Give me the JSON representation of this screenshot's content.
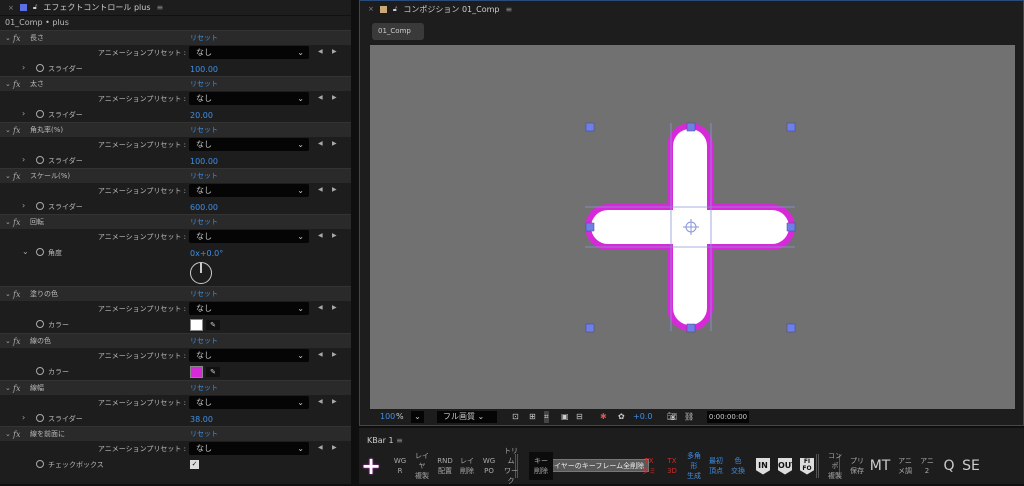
{
  "left_panel": {
    "title": "エフェクトコントロール plus",
    "subtitle": "01_Comp • plus",
    "color": "#5b6fe6",
    "effects": [
      {
        "name": "長さ",
        "reset": "リセット",
        "preset_label": "アニメーションプリセット :",
        "preset": "なし",
        "param": "スライダー",
        "value": "100.00",
        "kind": "slider"
      },
      {
        "name": "太さ",
        "reset": "リセット",
        "preset_label": "アニメーションプリセット :",
        "preset": "なし",
        "param": "スライダー",
        "value": "20.00",
        "kind": "slider"
      },
      {
        "name": "角丸率(%)",
        "reset": "リセット",
        "preset_label": "アニメーションプリセット :",
        "preset": "なし",
        "param": "スライダー",
        "value": "100.00",
        "kind": "slider"
      },
      {
        "name": "スケール(%)",
        "reset": "リセット",
        "preset_label": "アニメーションプリセット :",
        "preset": "なし",
        "param": "スライダー",
        "value": "600.00",
        "kind": "slider"
      },
      {
        "name": "回転",
        "reset": "リセット",
        "preset_label": "アニメーションプリセット :",
        "preset": "なし",
        "param": "角度",
        "value": "0x+0.0°",
        "kind": "angle"
      },
      {
        "name": "塗りの色",
        "reset": "リセット",
        "preset_label": "アニメーションプリセット :",
        "preset": "なし",
        "param": "カラー",
        "color": "#ffffff",
        "kind": "color"
      },
      {
        "name": "線の色",
        "reset": "リセット",
        "preset_label": "アニメーションプリセット :",
        "preset": "なし",
        "param": "カラー",
        "color": "#d62ad8",
        "kind": "color"
      },
      {
        "name": "線幅",
        "reset": "リセット",
        "preset_label": "アニメーションプリセット :",
        "preset": "なし",
        "param": "スライダー",
        "value": "38.00",
        "kind": "slider"
      },
      {
        "name": "線を前面に",
        "reset": "リセット",
        "preset_label": "アニメーションプリセット :",
        "preset": "なし",
        "param": "チェックボックス",
        "value": "✓",
        "kind": "checkbox"
      }
    ]
  },
  "comp_panel": {
    "title": "コンポジション 01_Comp",
    "tab": "01_Comp",
    "color": "#c9a978",
    "zoom": "100",
    "zoom_unit": "%",
    "quality": "フル画質",
    "exposure": "+0.0",
    "timecode": "0:00:00:00",
    "stroke_color": "#d62ad8"
  },
  "kbar": {
    "title": "KBar 1",
    "tooltip": "レイヤーのキーフレーム全削除",
    "buttons": [
      {
        "l1": "WG",
        "l2": "R"
      },
      {
        "l1": "レイヤ",
        "l2": "複製"
      },
      {
        "l1": "RND",
        "l2": "配置"
      },
      {
        "l1": "レイ",
        "l2": "削除"
      },
      {
        "l1": "WG",
        "l2": "PO"
      },
      {
        "l1": "トリム",
        "l2": "ワーク"
      },
      {
        "l1": "キー",
        "l2": "削除"
      },
      {
        "l1": "TX",
        "l2": "ダミ",
        "color": "#d02a2a"
      },
      {
        "l1": "TX",
        "l2": "3D",
        "color": "#d02a2a"
      },
      {
        "l1": "多角形",
        "l2": "生成",
        "color": "#3f8fe6"
      },
      {
        "l1": "最初",
        "l2": "頂点",
        "color": "#3f8fe6"
      },
      {
        "l1": "色",
        "l2": "交換",
        "color": "#3f8fe6"
      },
      {
        "shield": "IN"
      },
      {
        "shield": "OUT"
      },
      {
        "shield": "FI FO"
      },
      {
        "l1": "コンポ",
        "l2": "複製"
      },
      {
        "l1": "プリ",
        "l2": "保存"
      },
      {
        "big": "MT"
      },
      {
        "l1": "アニ",
        "l2": "メ調"
      },
      {
        "l1": "アニ",
        "l2": "2"
      },
      {
        "big": "Q"
      },
      {
        "big": "SE"
      }
    ]
  }
}
